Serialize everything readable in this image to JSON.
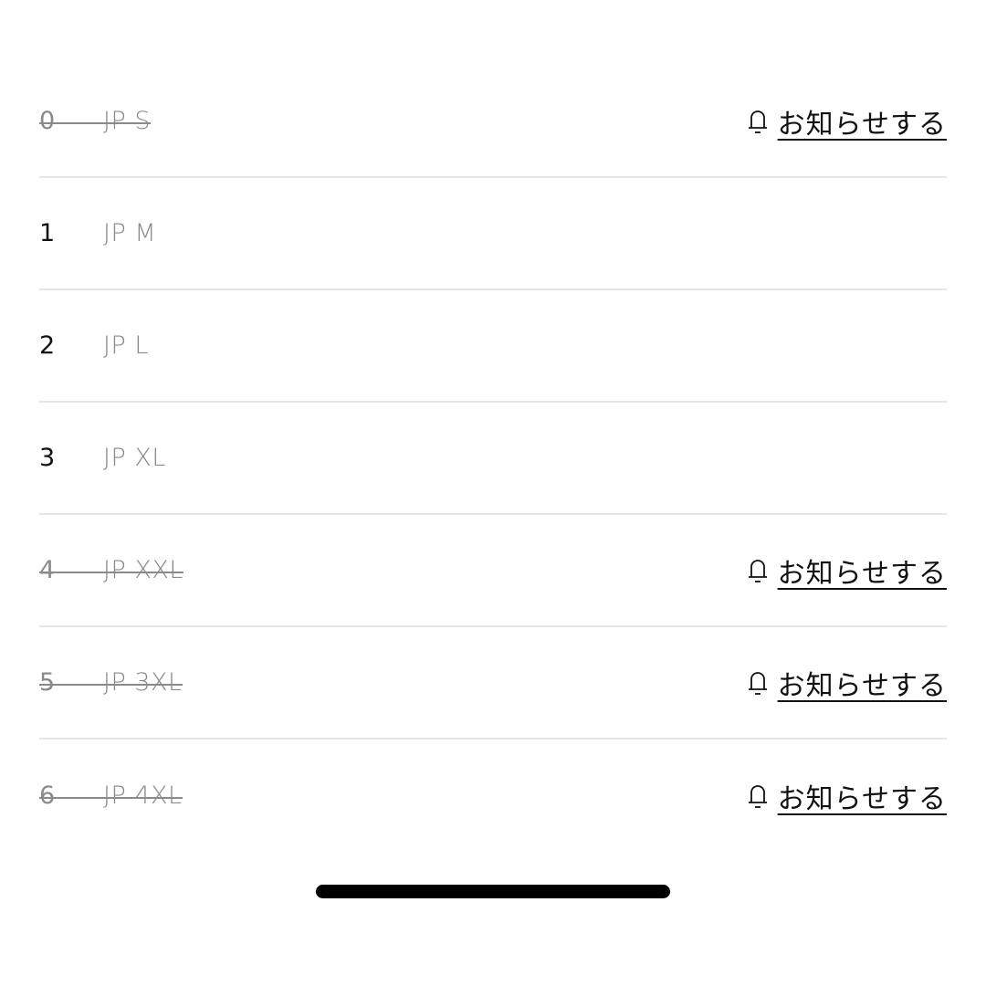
{
  "sizes": [
    {
      "number": "0",
      "label": "JP S",
      "available": false,
      "notify_label": "お知らせする"
    },
    {
      "number": "1",
      "label": "JP M",
      "available": true
    },
    {
      "number": "2",
      "label": "JP L",
      "available": true
    },
    {
      "number": "3",
      "label": "JP XL",
      "available": true
    },
    {
      "number": "4",
      "label": "JP XXL",
      "available": false,
      "notify_label": "お知らせする"
    },
    {
      "number": "5",
      "label": "JP 3XL",
      "available": false,
      "notify_label": "お知らせする"
    },
    {
      "number": "6",
      "label": "JP 4XL",
      "available": false,
      "notify_label": "お知らせする"
    }
  ],
  "icons": {
    "notify": "bell-icon"
  },
  "colors": {
    "text_primary": "#111111",
    "text_muted": "#8a8a8a",
    "divider": "#e6e6e6"
  }
}
